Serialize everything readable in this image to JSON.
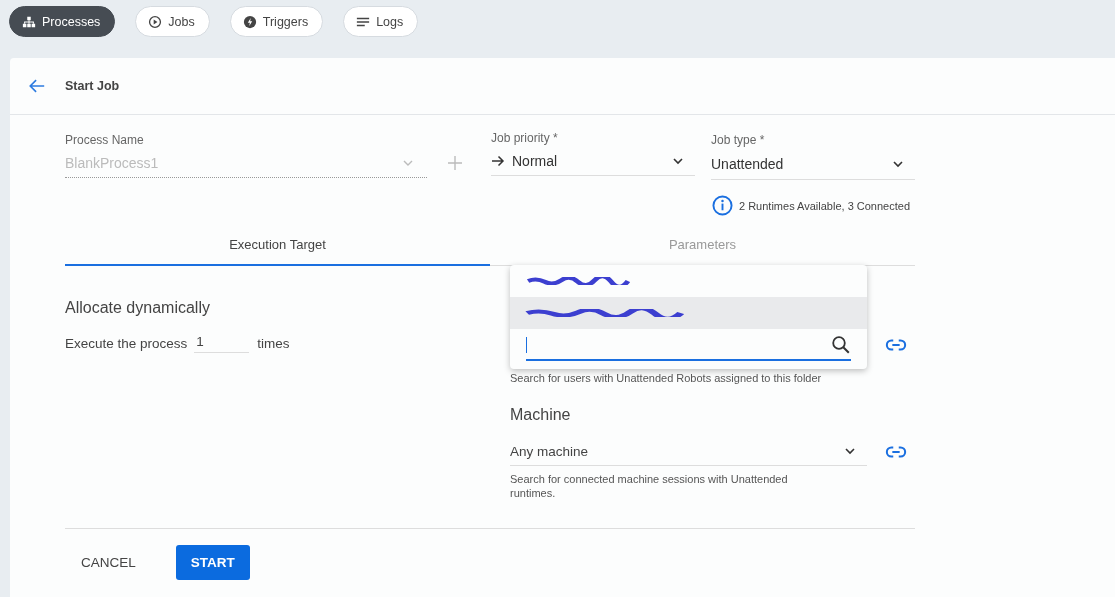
{
  "nav_tabs": [
    {
      "label": "Processes",
      "selected": true
    },
    {
      "label": "Jobs",
      "selected": false
    },
    {
      "label": "Triggers",
      "selected": false
    },
    {
      "label": "Logs",
      "selected": false
    }
  ],
  "page": {
    "title": "Start Job"
  },
  "form": {
    "process_name": {
      "label": "Process Name",
      "value": "BlankProcess1",
      "disabled": true
    },
    "job_priority": {
      "label": "Job priority *",
      "value": "Normal"
    },
    "job_type": {
      "label": "Job type *",
      "value": "Unattended"
    },
    "runtimes_info": "2 Runtimes Available, 3 Connected"
  },
  "tabs": [
    {
      "label": "Execution Target",
      "selected": true
    },
    {
      "label": "Parameters",
      "selected": false
    }
  ],
  "allocation": {
    "title": "Allocate dynamically",
    "prefix": "Execute the process",
    "count": "1",
    "suffix": "times"
  },
  "user_dropdown": {
    "options": [
      {
        "kind": "redacted",
        "selected": false
      },
      {
        "kind": "redacted",
        "selected": true
      }
    ],
    "hint": "Search for users with Unattended Robots assigned to this folder"
  },
  "machine": {
    "label": "Machine",
    "value": "Any machine",
    "hint": "Search for connected machine sessions with Unattended runtimes."
  },
  "buttons": {
    "cancel": "CANCEL",
    "start": "START"
  }
}
